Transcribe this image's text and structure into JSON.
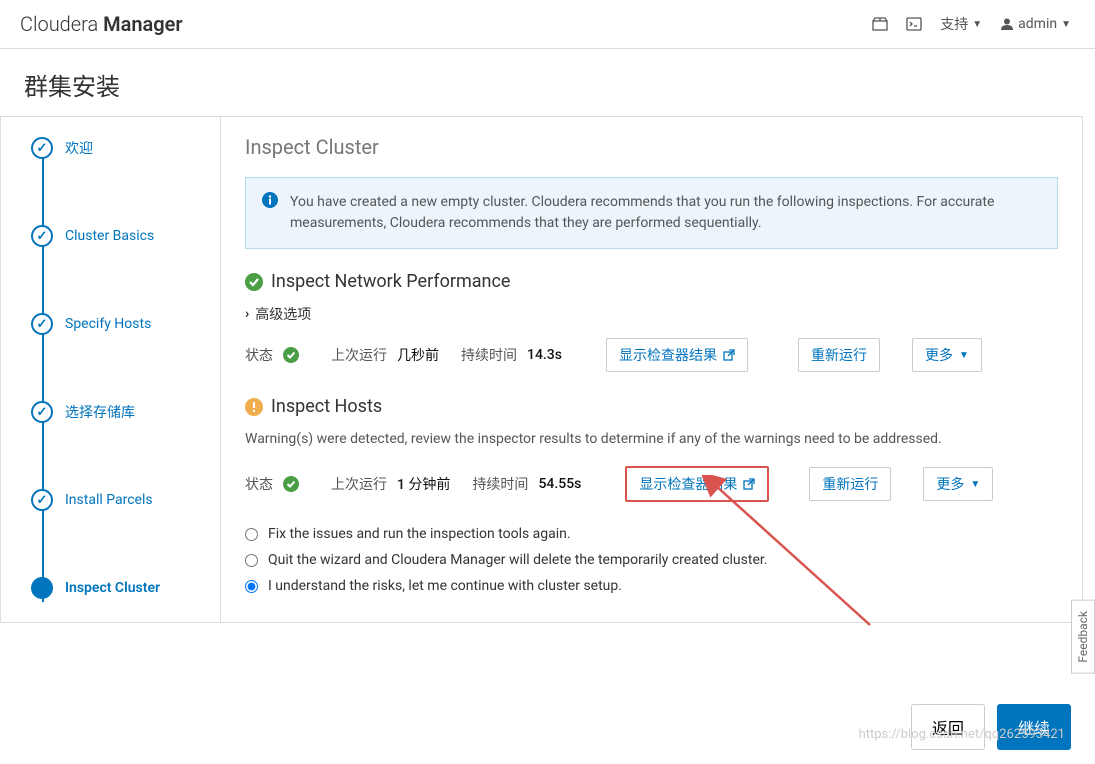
{
  "brand": {
    "light": "Cloudera ",
    "bold": "Manager"
  },
  "top_right": {
    "support": "支持",
    "user": "admin"
  },
  "page_title": "群集安装",
  "steps": [
    {
      "label": "欢迎"
    },
    {
      "label": "Cluster Basics"
    },
    {
      "label": "Specify Hosts"
    },
    {
      "label": "选择存储库"
    },
    {
      "label": "Install Parcels"
    },
    {
      "label": "Inspect Cluster"
    }
  ],
  "content": {
    "title": "Inspect Cluster",
    "info": "You have created a new empty cluster. Cloudera recommends that you run the following inspections. For accurate measurements, Cloudera recommends that they are performed sequentially.",
    "network": {
      "heading": "Inspect Network Performance",
      "adv": "高级选项",
      "status_label": "状态",
      "last_run_label": "上次运行",
      "last_run_value": "几秒前",
      "duration_label": "持续时间",
      "duration_value": "14.3s",
      "show_results": "显示检查器结果",
      "rerun": "重新运行",
      "more": "更多"
    },
    "hosts": {
      "heading": "Inspect Hosts",
      "warn": "Warning(s) were detected, review the inspector results to determine if any of the warnings need to be addressed.",
      "status_label": "状态",
      "last_run_label": "上次运行",
      "last_run_value": "1 分钟前",
      "duration_label": "持续时间",
      "duration_value": "54.55s",
      "show_results": "显示检查器结果",
      "rerun": "重新运行",
      "more": "更多"
    },
    "options": {
      "fix": "Fix the issues and run the inspection tools again.",
      "quit": "Quit the wizard and Cloudera Manager will delete the temporarily created cluster.",
      "understand": "I understand the risks, let me continue with cluster setup."
    }
  },
  "footer": {
    "back": "返回",
    "continue": "继续"
  },
  "feedback": "Feedback",
  "watermark": "https://blog.csdn.net/qq262593421"
}
